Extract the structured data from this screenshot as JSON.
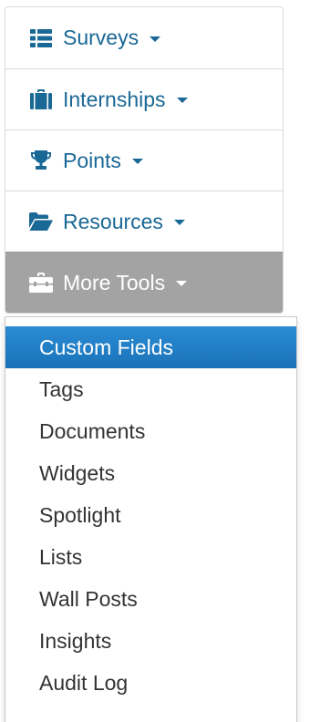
{
  "nav": {
    "items": [
      {
        "label": "Surveys",
        "icon": "list-icon"
      },
      {
        "label": "Internships",
        "icon": "briefcase-icon"
      },
      {
        "label": "Points",
        "icon": "trophy-icon"
      },
      {
        "label": "Resources",
        "icon": "folder-open-icon"
      },
      {
        "label": "More Tools",
        "icon": "toolbox-icon",
        "active": true
      }
    ]
  },
  "menu": {
    "items": [
      {
        "label": "Custom Fields",
        "highlighted": true
      },
      {
        "label": "Tags"
      },
      {
        "label": "Documents"
      },
      {
        "label": "Widgets"
      },
      {
        "label": "Spotlight"
      },
      {
        "label": "Lists"
      },
      {
        "label": "Wall Posts"
      },
      {
        "label": "Insights"
      },
      {
        "label": "Audit Log"
      }
    ]
  },
  "colors": {
    "link": "#1a6896",
    "active_bg": "#a3a3a3",
    "highlight_bg": "#2280c8",
    "menu_text": "#333333"
  }
}
